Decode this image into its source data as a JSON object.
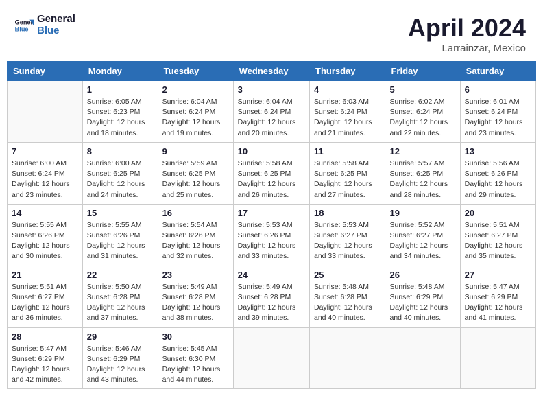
{
  "header": {
    "logo_line1": "General",
    "logo_line2": "Blue",
    "month": "April 2024",
    "location": "Larrainzar, Mexico"
  },
  "weekdays": [
    "Sunday",
    "Monday",
    "Tuesday",
    "Wednesday",
    "Thursday",
    "Friday",
    "Saturday"
  ],
  "weeks": [
    [
      {
        "day": "",
        "info": ""
      },
      {
        "day": "1",
        "info": "Sunrise: 6:05 AM\nSunset: 6:23 PM\nDaylight: 12 hours\nand 18 minutes."
      },
      {
        "day": "2",
        "info": "Sunrise: 6:04 AM\nSunset: 6:24 PM\nDaylight: 12 hours\nand 19 minutes."
      },
      {
        "day": "3",
        "info": "Sunrise: 6:04 AM\nSunset: 6:24 PM\nDaylight: 12 hours\nand 20 minutes."
      },
      {
        "day": "4",
        "info": "Sunrise: 6:03 AM\nSunset: 6:24 PM\nDaylight: 12 hours\nand 21 minutes."
      },
      {
        "day": "5",
        "info": "Sunrise: 6:02 AM\nSunset: 6:24 PM\nDaylight: 12 hours\nand 22 minutes."
      },
      {
        "day": "6",
        "info": "Sunrise: 6:01 AM\nSunset: 6:24 PM\nDaylight: 12 hours\nand 23 minutes."
      }
    ],
    [
      {
        "day": "7",
        "info": "Sunrise: 6:00 AM\nSunset: 6:24 PM\nDaylight: 12 hours\nand 23 minutes."
      },
      {
        "day": "8",
        "info": "Sunrise: 6:00 AM\nSunset: 6:25 PM\nDaylight: 12 hours\nand 24 minutes."
      },
      {
        "day": "9",
        "info": "Sunrise: 5:59 AM\nSunset: 6:25 PM\nDaylight: 12 hours\nand 25 minutes."
      },
      {
        "day": "10",
        "info": "Sunrise: 5:58 AM\nSunset: 6:25 PM\nDaylight: 12 hours\nand 26 minutes."
      },
      {
        "day": "11",
        "info": "Sunrise: 5:58 AM\nSunset: 6:25 PM\nDaylight: 12 hours\nand 27 minutes."
      },
      {
        "day": "12",
        "info": "Sunrise: 5:57 AM\nSunset: 6:25 PM\nDaylight: 12 hours\nand 28 minutes."
      },
      {
        "day": "13",
        "info": "Sunrise: 5:56 AM\nSunset: 6:26 PM\nDaylight: 12 hours\nand 29 minutes."
      }
    ],
    [
      {
        "day": "14",
        "info": "Sunrise: 5:55 AM\nSunset: 6:26 PM\nDaylight: 12 hours\nand 30 minutes."
      },
      {
        "day": "15",
        "info": "Sunrise: 5:55 AM\nSunset: 6:26 PM\nDaylight: 12 hours\nand 31 minutes."
      },
      {
        "day": "16",
        "info": "Sunrise: 5:54 AM\nSunset: 6:26 PM\nDaylight: 12 hours\nand 32 minutes."
      },
      {
        "day": "17",
        "info": "Sunrise: 5:53 AM\nSunset: 6:26 PM\nDaylight: 12 hours\nand 33 minutes."
      },
      {
        "day": "18",
        "info": "Sunrise: 5:53 AM\nSunset: 6:27 PM\nDaylight: 12 hours\nand 33 minutes."
      },
      {
        "day": "19",
        "info": "Sunrise: 5:52 AM\nSunset: 6:27 PM\nDaylight: 12 hours\nand 34 minutes."
      },
      {
        "day": "20",
        "info": "Sunrise: 5:51 AM\nSunset: 6:27 PM\nDaylight: 12 hours\nand 35 minutes."
      }
    ],
    [
      {
        "day": "21",
        "info": "Sunrise: 5:51 AM\nSunset: 6:27 PM\nDaylight: 12 hours\nand 36 minutes."
      },
      {
        "day": "22",
        "info": "Sunrise: 5:50 AM\nSunset: 6:28 PM\nDaylight: 12 hours\nand 37 minutes."
      },
      {
        "day": "23",
        "info": "Sunrise: 5:49 AM\nSunset: 6:28 PM\nDaylight: 12 hours\nand 38 minutes."
      },
      {
        "day": "24",
        "info": "Sunrise: 5:49 AM\nSunset: 6:28 PM\nDaylight: 12 hours\nand 39 minutes."
      },
      {
        "day": "25",
        "info": "Sunrise: 5:48 AM\nSunset: 6:28 PM\nDaylight: 12 hours\nand 40 minutes."
      },
      {
        "day": "26",
        "info": "Sunrise: 5:48 AM\nSunset: 6:29 PM\nDaylight: 12 hours\nand 40 minutes."
      },
      {
        "day": "27",
        "info": "Sunrise: 5:47 AM\nSunset: 6:29 PM\nDaylight: 12 hours\nand 41 minutes."
      }
    ],
    [
      {
        "day": "28",
        "info": "Sunrise: 5:47 AM\nSunset: 6:29 PM\nDaylight: 12 hours\nand 42 minutes."
      },
      {
        "day": "29",
        "info": "Sunrise: 5:46 AM\nSunset: 6:29 PM\nDaylight: 12 hours\nand 43 minutes."
      },
      {
        "day": "30",
        "info": "Sunrise: 5:45 AM\nSunset: 6:30 PM\nDaylight: 12 hours\nand 44 minutes."
      },
      {
        "day": "",
        "info": ""
      },
      {
        "day": "",
        "info": ""
      },
      {
        "day": "",
        "info": ""
      },
      {
        "day": "",
        "info": ""
      }
    ]
  ]
}
